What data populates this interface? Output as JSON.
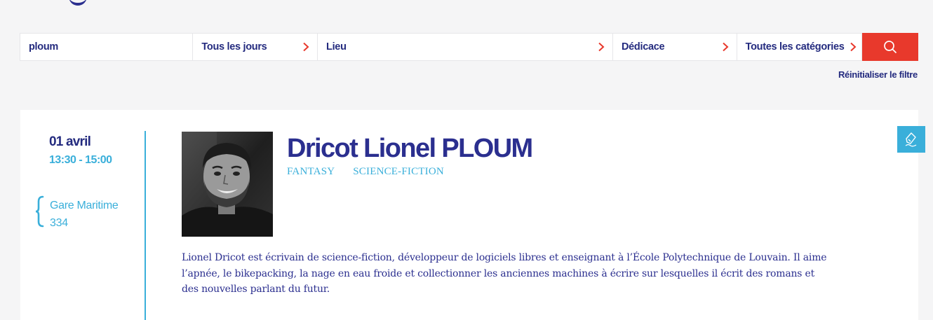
{
  "search": {
    "value": "ploum"
  },
  "filters": {
    "days": "Tous les jours",
    "place": "Lieu",
    "dedicace": "Dédicace",
    "categories": "Toutes les catégories"
  },
  "reset_label": "Réinitialiser le filtre",
  "event": {
    "date": "01 avril",
    "time": "13:30 - 15:00",
    "location_line1": "Gare Maritime",
    "location_line2": "334",
    "author": "Dricot Lionel PLOUM",
    "tags": [
      "FANTASY",
      "SCIENCE-FICTION"
    ],
    "bio": "Lionel Dricot est écrivain de science-fiction, développeur de logiciels libres et enseignant à l’École Polytechnique de Louvain. Il aime l’apnée, le bikepacking, la nage en eau froide et collectionner les anciennes machines à écrire sur lesquelles il écrit des romans et des nouvelles parlant du futur."
  },
  "icons": {
    "chevron": "chevron-right-icon",
    "search": "search-icon",
    "brace": "location-brace-icon",
    "edit": "signature-pen-icon"
  },
  "colors": {
    "navy": "#2b2f8f",
    "cyan": "#3aafda",
    "red": "#e8392c",
    "background": "#f5f5f6"
  }
}
